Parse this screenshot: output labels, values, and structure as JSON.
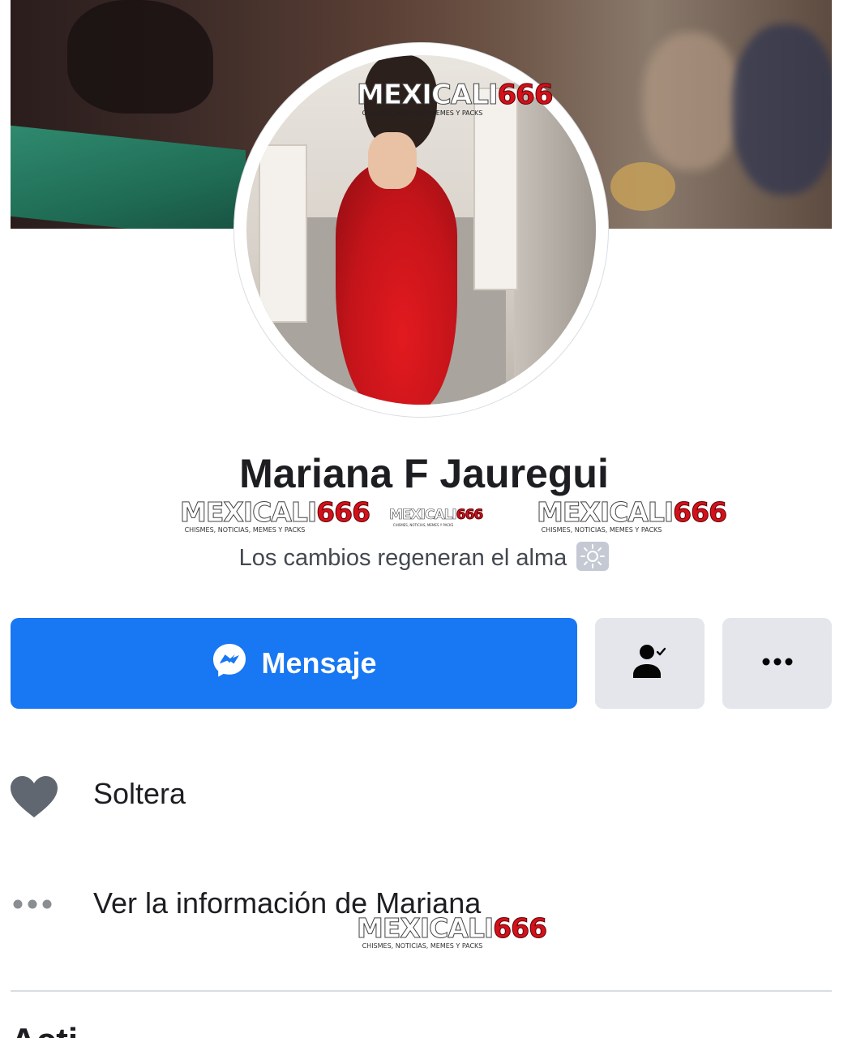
{
  "profile": {
    "name": "Mariana F Jauregui",
    "bio": "Los cambios regeneran el alma",
    "bio_icon": "sun-emoji"
  },
  "watermark": {
    "brand": "MEXICALI",
    "number": "666",
    "tagline": "CHISMES, NOTICIAS, MEMES Y PACKS"
  },
  "actions": {
    "message_label": "Mensaje",
    "message_icon": "messenger-icon",
    "friend_icon": "friend-check-icon",
    "more_icon": "ellipsis-icon"
  },
  "info": {
    "relationship": "Soltera",
    "relationship_icon": "heart-icon",
    "see_info": "Ver la información de Mariana",
    "see_info_icon": "dots-icon"
  },
  "next_section_partial": "Acti",
  "colors": {
    "primary": "#1877f2",
    "secondary_button": "#e4e6eb",
    "text": "#1c1e21",
    "icon_gray": "#606770"
  }
}
